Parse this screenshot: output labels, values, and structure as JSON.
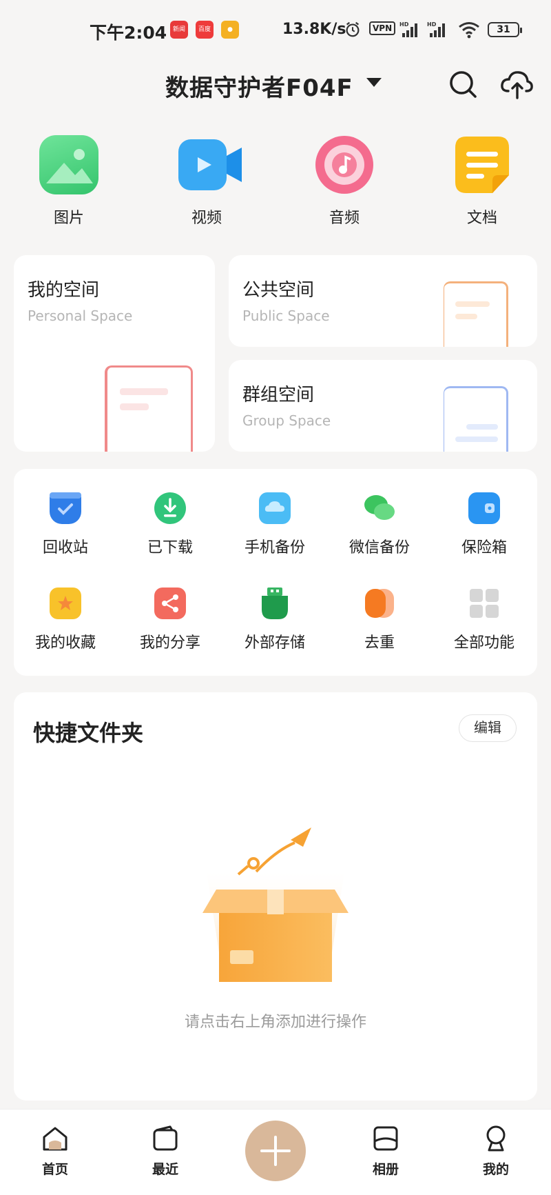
{
  "status_bar": {
    "time": "下午2:04",
    "app_icons": [
      "新闻",
      "百度",
      "●"
    ],
    "speed": "13.8K/s",
    "vpn": "VPN",
    "battery": "31"
  },
  "header": {
    "title": "数据守护者F04F"
  },
  "categories": [
    {
      "label": "图片",
      "icon": "image-icon",
      "color": "#4cd27c"
    },
    {
      "label": "视频",
      "icon": "video-icon",
      "color": "#3fb2f5"
    },
    {
      "label": "音频",
      "icon": "audio-icon",
      "color": "#f26b8c"
    },
    {
      "label": "文档",
      "icon": "document-icon",
      "color": "#f9b81b"
    }
  ],
  "spaces": {
    "personal": {
      "title": "我的空间",
      "subtitle": "Personal Space"
    },
    "public": {
      "title": "公共空间",
      "subtitle": "Public Space"
    },
    "group": {
      "title": "群组空间",
      "subtitle": "Group Space"
    }
  },
  "functions": [
    {
      "label": "回收站",
      "icon": "recycle-bin-icon",
      "color": "#2f7de8"
    },
    {
      "label": "已下载",
      "icon": "download-icon",
      "color": "#31c57b"
    },
    {
      "label": "手机备份",
      "icon": "phone-backup-icon",
      "color": "#4bbcf5"
    },
    {
      "label": "微信备份",
      "icon": "wechat-backup-icon",
      "color": "#3cc45f"
    },
    {
      "label": "保险箱",
      "icon": "safe-box-icon",
      "color": "#2a95f2"
    },
    {
      "label": "我的收藏",
      "icon": "favorite-icon",
      "color": "#f8c22a"
    },
    {
      "label": "我的分享",
      "icon": "share-icon",
      "color": "#f36a5e"
    },
    {
      "label": "外部存储",
      "icon": "usb-storage-icon",
      "color": "#1f9b4c"
    },
    {
      "label": "去重",
      "icon": "dedupe-icon",
      "color": "#f57a22"
    },
    {
      "label": "全部功能",
      "icon": "all-functions-icon",
      "color": "#d6d6d6"
    }
  ],
  "quick_folders": {
    "title": "快捷文件夹",
    "edit_label": "编辑",
    "empty_text": "请点击右上角添加进行操作"
  },
  "bottom_nav": [
    {
      "label": "首页",
      "icon": "home-icon"
    },
    {
      "label": "最近",
      "icon": "recent-icon"
    },
    {
      "label": "相册",
      "icon": "album-icon"
    },
    {
      "label": "我的",
      "icon": "profile-icon"
    }
  ],
  "colors": {
    "accent": "#d9b89a",
    "background": "#f6f5f4"
  }
}
